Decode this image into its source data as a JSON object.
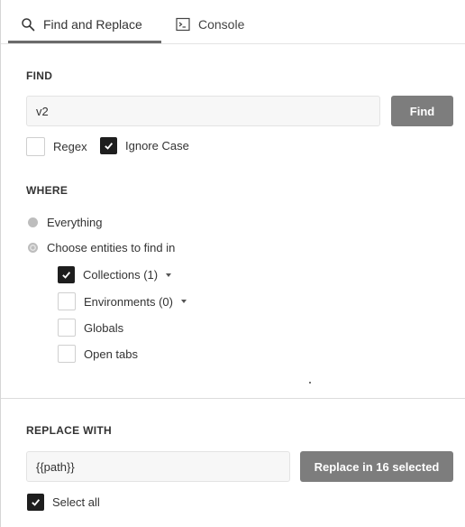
{
  "tabs": {
    "find_replace": {
      "label": "Find and Replace",
      "icon": "search-icon"
    },
    "console": {
      "label": "Console",
      "icon": "terminal-icon"
    }
  },
  "find": {
    "section_label": "FIND",
    "input_value": "v2",
    "button_label": "Find",
    "options": {
      "regex": {
        "label": "Regex",
        "checked": false
      },
      "ignore_case": {
        "label": "Ignore Case",
        "checked": true
      }
    }
  },
  "where": {
    "section_label": "WHERE",
    "radios": [
      {
        "label": "Everything",
        "selected": false
      },
      {
        "label": "Choose entities to find in",
        "selected": true
      }
    ],
    "entities": [
      {
        "label": "Collections (1)",
        "checked": true,
        "has_dropdown": true
      },
      {
        "label": "Environments (0)",
        "checked": false,
        "has_dropdown": true
      },
      {
        "label": "Globals",
        "checked": false,
        "has_dropdown": false
      },
      {
        "label": "Open tabs",
        "checked": false,
        "has_dropdown": false
      }
    ]
  },
  "replace": {
    "section_label": "REPLACE WITH",
    "input_value": "{{path}}",
    "button_label": "Replace in 16 selected",
    "select_all": {
      "label": "Select all",
      "checked": true
    }
  },
  "colors": {
    "button_bg": "#7d7d7d",
    "checkbox_checked": "#1e1e1e",
    "tab_underline": "#6b6b6b"
  }
}
